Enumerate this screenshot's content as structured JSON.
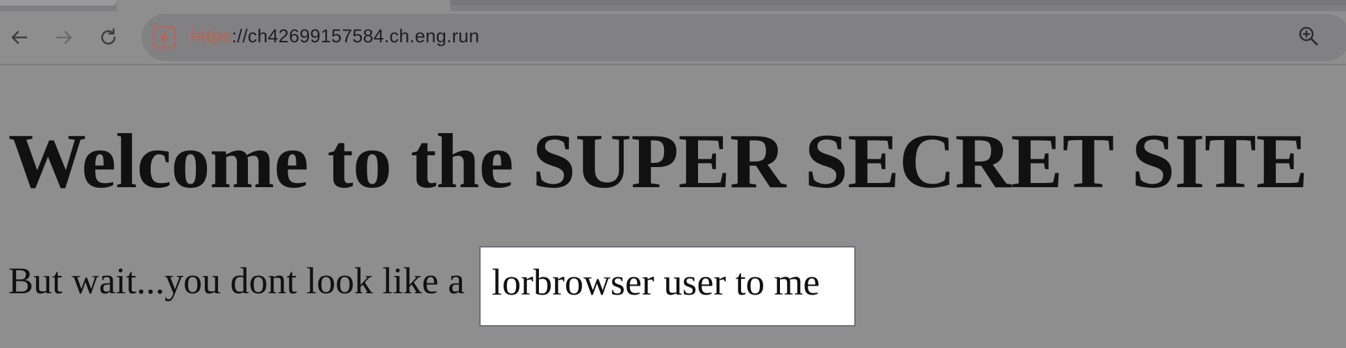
{
  "browser": {
    "url_scheme": "https",
    "url_rest": "://ch42699157584.ch.eng.run",
    "icons": {
      "back": "arrow-left-icon",
      "forward": "arrow-right-icon",
      "reload": "reload-icon",
      "site_security": "site-warning-icon",
      "zoom": "zoom-in-icon"
    }
  },
  "page": {
    "heading": "Welcome to the SUPER SECRET SITE",
    "subline": "But wait...you dont look like a"
  },
  "popup": {
    "text": "lorbrowser user to me"
  },
  "colors": {
    "background": "#8e8e8f",
    "text": "#111111",
    "scheme_strike": "#b1675a",
    "popup_bg": "#ffffff"
  }
}
